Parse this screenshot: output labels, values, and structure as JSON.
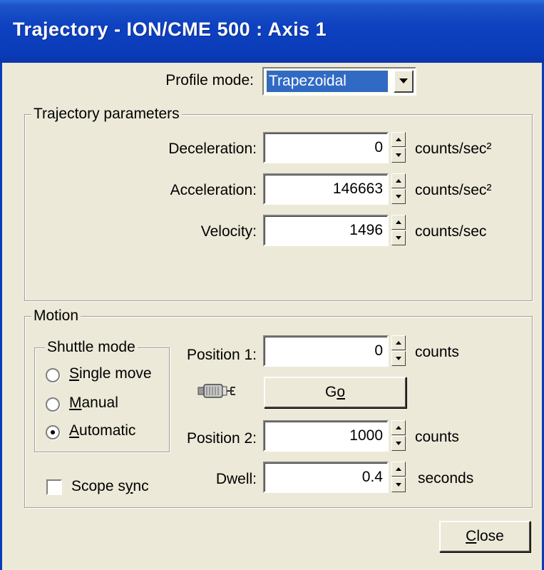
{
  "window": {
    "title": "Trajectory - ION/CME 500 :  Axis 1"
  },
  "profile": {
    "label": "Profile mode:",
    "value": "Trapezoidal"
  },
  "trajectory": {
    "group_title": "Trajectory parameters",
    "deceleration": {
      "label": "Deceleration:",
      "value": "0",
      "unit": "counts/sec²"
    },
    "acceleration": {
      "label": "Acceleration:",
      "value": "146663",
      "unit": "counts/sec²"
    },
    "velocity": {
      "label": "Velocity:",
      "value": "1496",
      "unit": "counts/sec"
    }
  },
  "motion": {
    "group_title": "Motion",
    "shuttle": {
      "group_title": "Shuttle mode",
      "single_pre": "",
      "single_u": "S",
      "single_post": "ingle move",
      "manual_u": "M",
      "manual_post": "anual",
      "auto_u": "A",
      "auto_post": "utomatic",
      "selected": "Automatic"
    },
    "position1": {
      "label": "Position 1:",
      "value": "0",
      "unit": "counts"
    },
    "go": {
      "pre": "G",
      "u": "o"
    },
    "position2": {
      "label": "Position 2:",
      "value": "1000",
      "unit": "counts"
    },
    "dwell": {
      "label": "Dwell:",
      "value": "0.4",
      "unit": "seconds"
    },
    "scope_sync": {
      "pre": "Scope s",
      "u": "y",
      "post": "nc",
      "checked": false
    }
  },
  "close": {
    "u": "C",
    "post": "lose"
  },
  "icons": {
    "connector": "connector-icon"
  },
  "colors": {
    "titlebar": "#0a3cb9",
    "selection": "#316ac5",
    "face": "#ece9d8"
  }
}
